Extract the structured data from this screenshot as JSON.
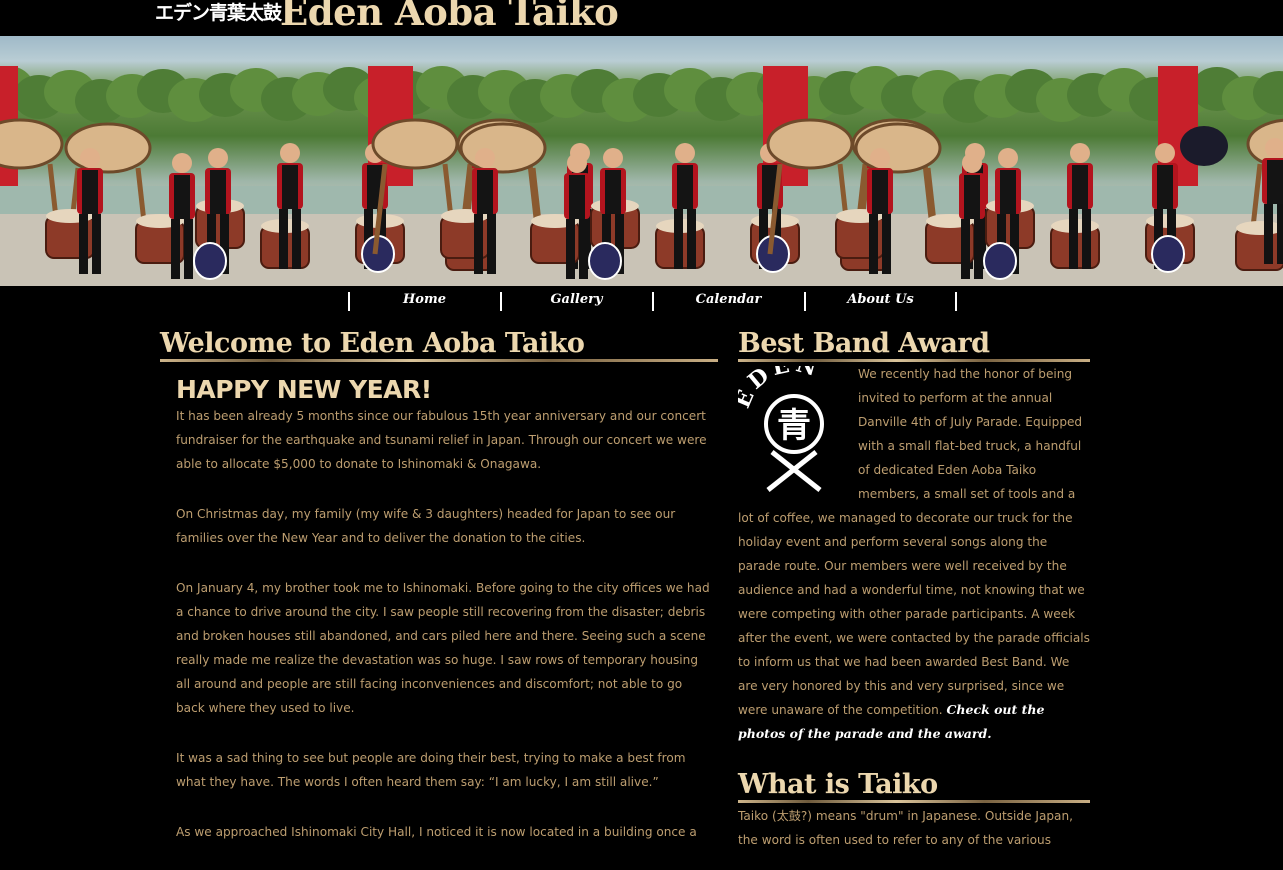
{
  "header": {
    "logo_jp": "エデン青葉太鼓",
    "title": "Eden Aoba Taiko"
  },
  "nav": {
    "items": [
      {
        "label": "Home"
      },
      {
        "label": "Gallery"
      },
      {
        "label": "Calendar"
      },
      {
        "label": "About Us"
      }
    ]
  },
  "welcome": {
    "heading": "Welcome to Eden Aoba Taiko",
    "subheading": "HAPPY NEW YEAR!",
    "paragraphs": [
      "It has been already 5 months since our fabulous 15th year anniversary and our concert fundraiser for the earthquake and tsunami relief in Japan. Through our concert we were able to allocate $5,000 to donate to Ishinomaki & Onagawa.",
      "On Christmas day, my family (my wife & 3 daughters) headed for Japan to see our families over the New Year and to deliver the donation to the cities.",
      "On January 4, my brother took me to Ishinomaki. Before going to the city offices we had a chance to drive around the city. I saw people still recovering from the disaster; debris and broken houses still abandoned, and cars piled here and there. Seeing such a scene really made me realize the devastation was so huge. I saw rows of temporary housing all around and people are still facing inconveniences and discomfort; not able to go back where they used to live.",
      "It was a sad thing to see but people are doing their best, trying to make a best from what they have. The words I often heard them say: “I am lucky, I am still alive.”",
      "As we approached Ishinomaki City Hall, I noticed it is now located in a building once a"
    ]
  },
  "award": {
    "heading": "Best Band Award",
    "text": "We recently had the honor of being invited to perform at the annual Danville 4th of July Parade. Equipped with a small flat-bed truck, a handful of dedicated Eden Aoba Taiko members, a small set of tools and a lot of coffee, we managed to decorate our truck for the holiday event and perform several songs along the parade route. Our members were well received by the audience and had a wonderful time, not knowing that we were competing with other parade participants. A week after the event, we were contacted by the parade officials to inform us that we had been awarded Best Band. We are very honored by this and very surprised, since we were unaware of the competition.",
    "link": "Check out the photos of the parade and the award.",
    "emblem_text": "EDEN",
    "emblem_kanji": "青"
  },
  "taiko": {
    "heading": "What is Taiko",
    "text": "Taiko (太鼓?) means \"drum\" in Japanese. Outside Japan, the word is often used to refer to any of the various"
  },
  "colors": {
    "heading": "#ecd7ae",
    "body_text": "#bd9e70",
    "background": "#000000",
    "nav_text": "#ffffff"
  }
}
